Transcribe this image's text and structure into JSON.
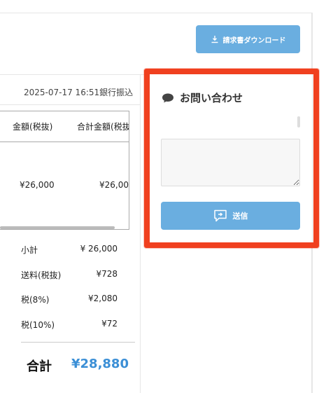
{
  "header": {
    "download_button_label": "請求書ダウンロード",
    "download_icon": "download-icon"
  },
  "order": {
    "datetime_payment": "2025-07-17 16:51銀行振込",
    "table": {
      "columns": [
        "金額(税抜)",
        "合計金額(税抜"
      ],
      "rows": [
        {
          "amount": "¥26,000",
          "total": "¥26,00"
        }
      ]
    },
    "summary": [
      {
        "label": "小計",
        "value": "¥ 26,000"
      },
      {
        "label": "送料(税抜)",
        "value": "¥728"
      },
      {
        "label": "税(8%)",
        "value": "¥2,080"
      },
      {
        "label": "税(10%)",
        "value": "¥72"
      }
    ],
    "grand_total": {
      "label": "合計",
      "value": "¥28,880"
    }
  },
  "contact": {
    "title": "お問い合わせ",
    "title_icon": "chat-bubble-icon",
    "message_value": "",
    "send_button_label": "送信",
    "send_icon": "send-message-icon"
  },
  "colors": {
    "accent": "#6aaee0",
    "total_blue": "#3b8fd6",
    "annotation_red": "#f0401f"
  }
}
